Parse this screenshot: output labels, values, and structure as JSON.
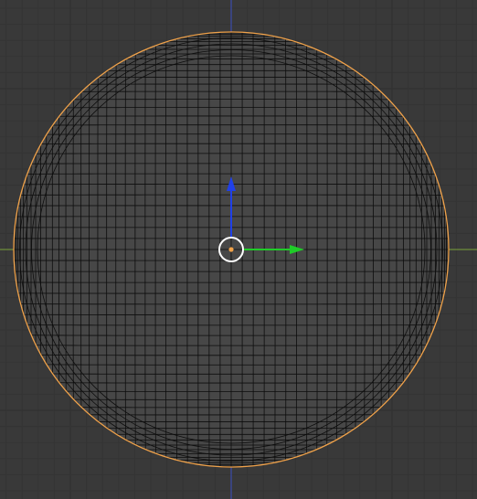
{
  "viewport": {
    "view": "top-orthographic",
    "colors": {
      "background": "#393939",
      "grid_minor": "#343434",
      "grid_major": "#2f2f2f",
      "x_axis_line": "#7aa23a",
      "y_axis_line": "#3b4fc4",
      "mesh_fill": "#474747",
      "mesh_wire": "#0d0d0d",
      "selection_outline": "#f0a24a",
      "pivot_dot": "#f0a24a",
      "cursor_ring": "#ffffff"
    }
  },
  "object": {
    "type": "uv-sphere",
    "selected": true
  },
  "gizmo": {
    "mode": "translate",
    "axes": [
      {
        "axis": "X",
        "color": "#1fcc28"
      },
      {
        "axis": "Y",
        "color": "#2040e8"
      }
    ]
  },
  "cursor_3d": {
    "icon": "cursor-3d-icon"
  }
}
